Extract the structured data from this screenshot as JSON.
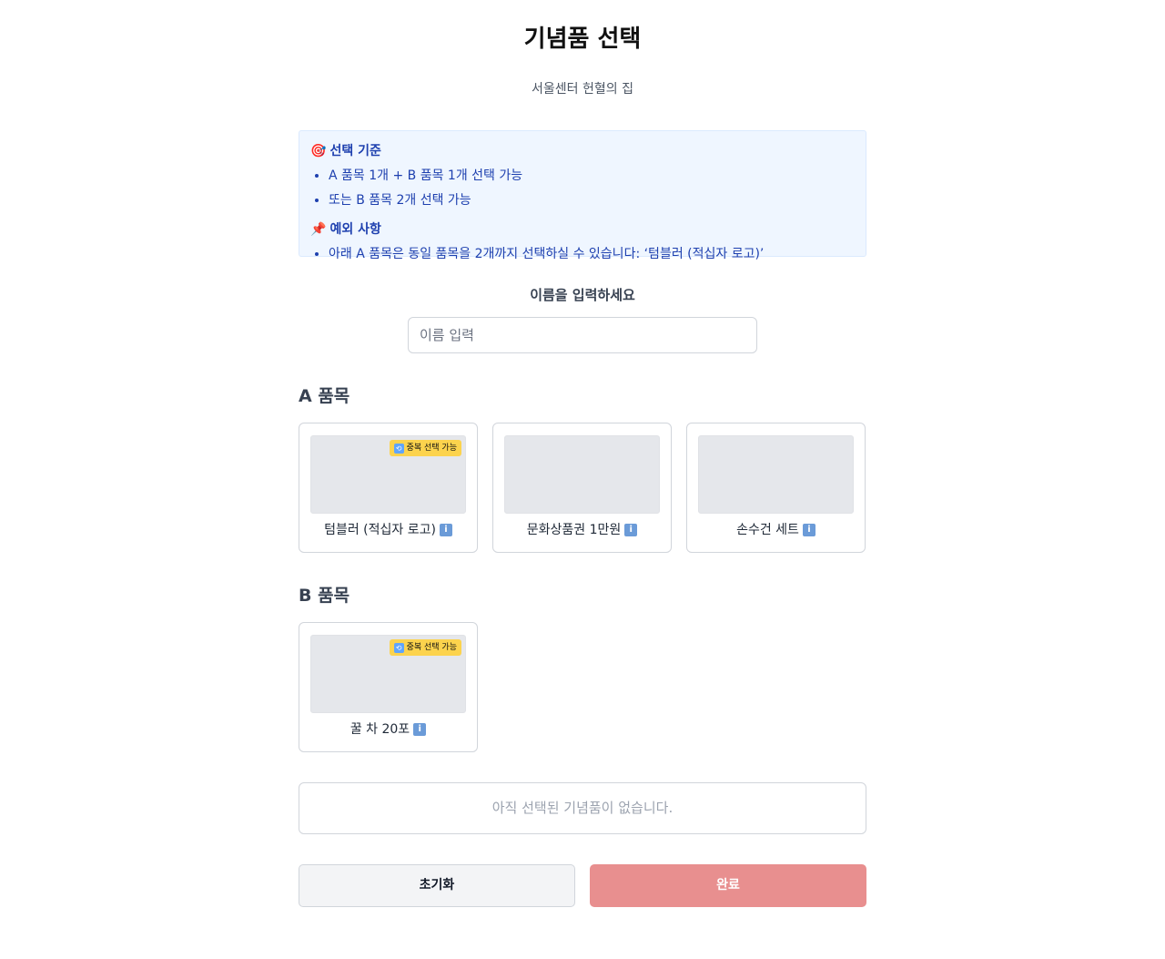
{
  "page": {
    "title": "기념품 선택",
    "subtitle": "서울센터 헌혈의 집"
  },
  "rules": {
    "criteria_icon": "🎯",
    "criteria_title": "선택 기준",
    "criteria_items": [
      "A 품목 1개 + B 품목 1개 선택 가능",
      "또는 B 품목 2개 선택 가능"
    ],
    "exception_icon": "📌",
    "exception_title": "예외 사항",
    "exception_items": [
      "아래 A 품목은 동일 품목을 2개까지 선택하실 수 있습니다: ‘텀블러 (적십자 로고)’"
    ]
  },
  "name": {
    "label": "이름을 입력하세요",
    "placeholder": "이름 입력",
    "value": ""
  },
  "section_a": {
    "title": "A 품목",
    "items": [
      {
        "label": "텀블러 (적십자 로고)",
        "badge": "중복 선택 가능",
        "info_icon": "info-icon"
      },
      {
        "label": "문화상품권 1만원",
        "badge": "",
        "info_icon": "info-icon"
      },
      {
        "label": "손수건 세트",
        "badge": "",
        "info_icon": "info-icon"
      }
    ]
  },
  "section_b": {
    "title": "B 품목",
    "items": [
      {
        "label": "꿀 차 20포",
        "badge": "중복 선택 가능",
        "info_icon": "info-icon"
      }
    ]
  },
  "summary": {
    "empty_text": "아직 선택된 기념품이 없습니다."
  },
  "buttons": {
    "reset_label": "초기화",
    "done_label": "완료"
  },
  "colors": {
    "rules_bg": "#eff6ff",
    "rules_text": "#1e40af",
    "badge_bg": "#fcd34d",
    "done_button": "#e88f8f"
  }
}
